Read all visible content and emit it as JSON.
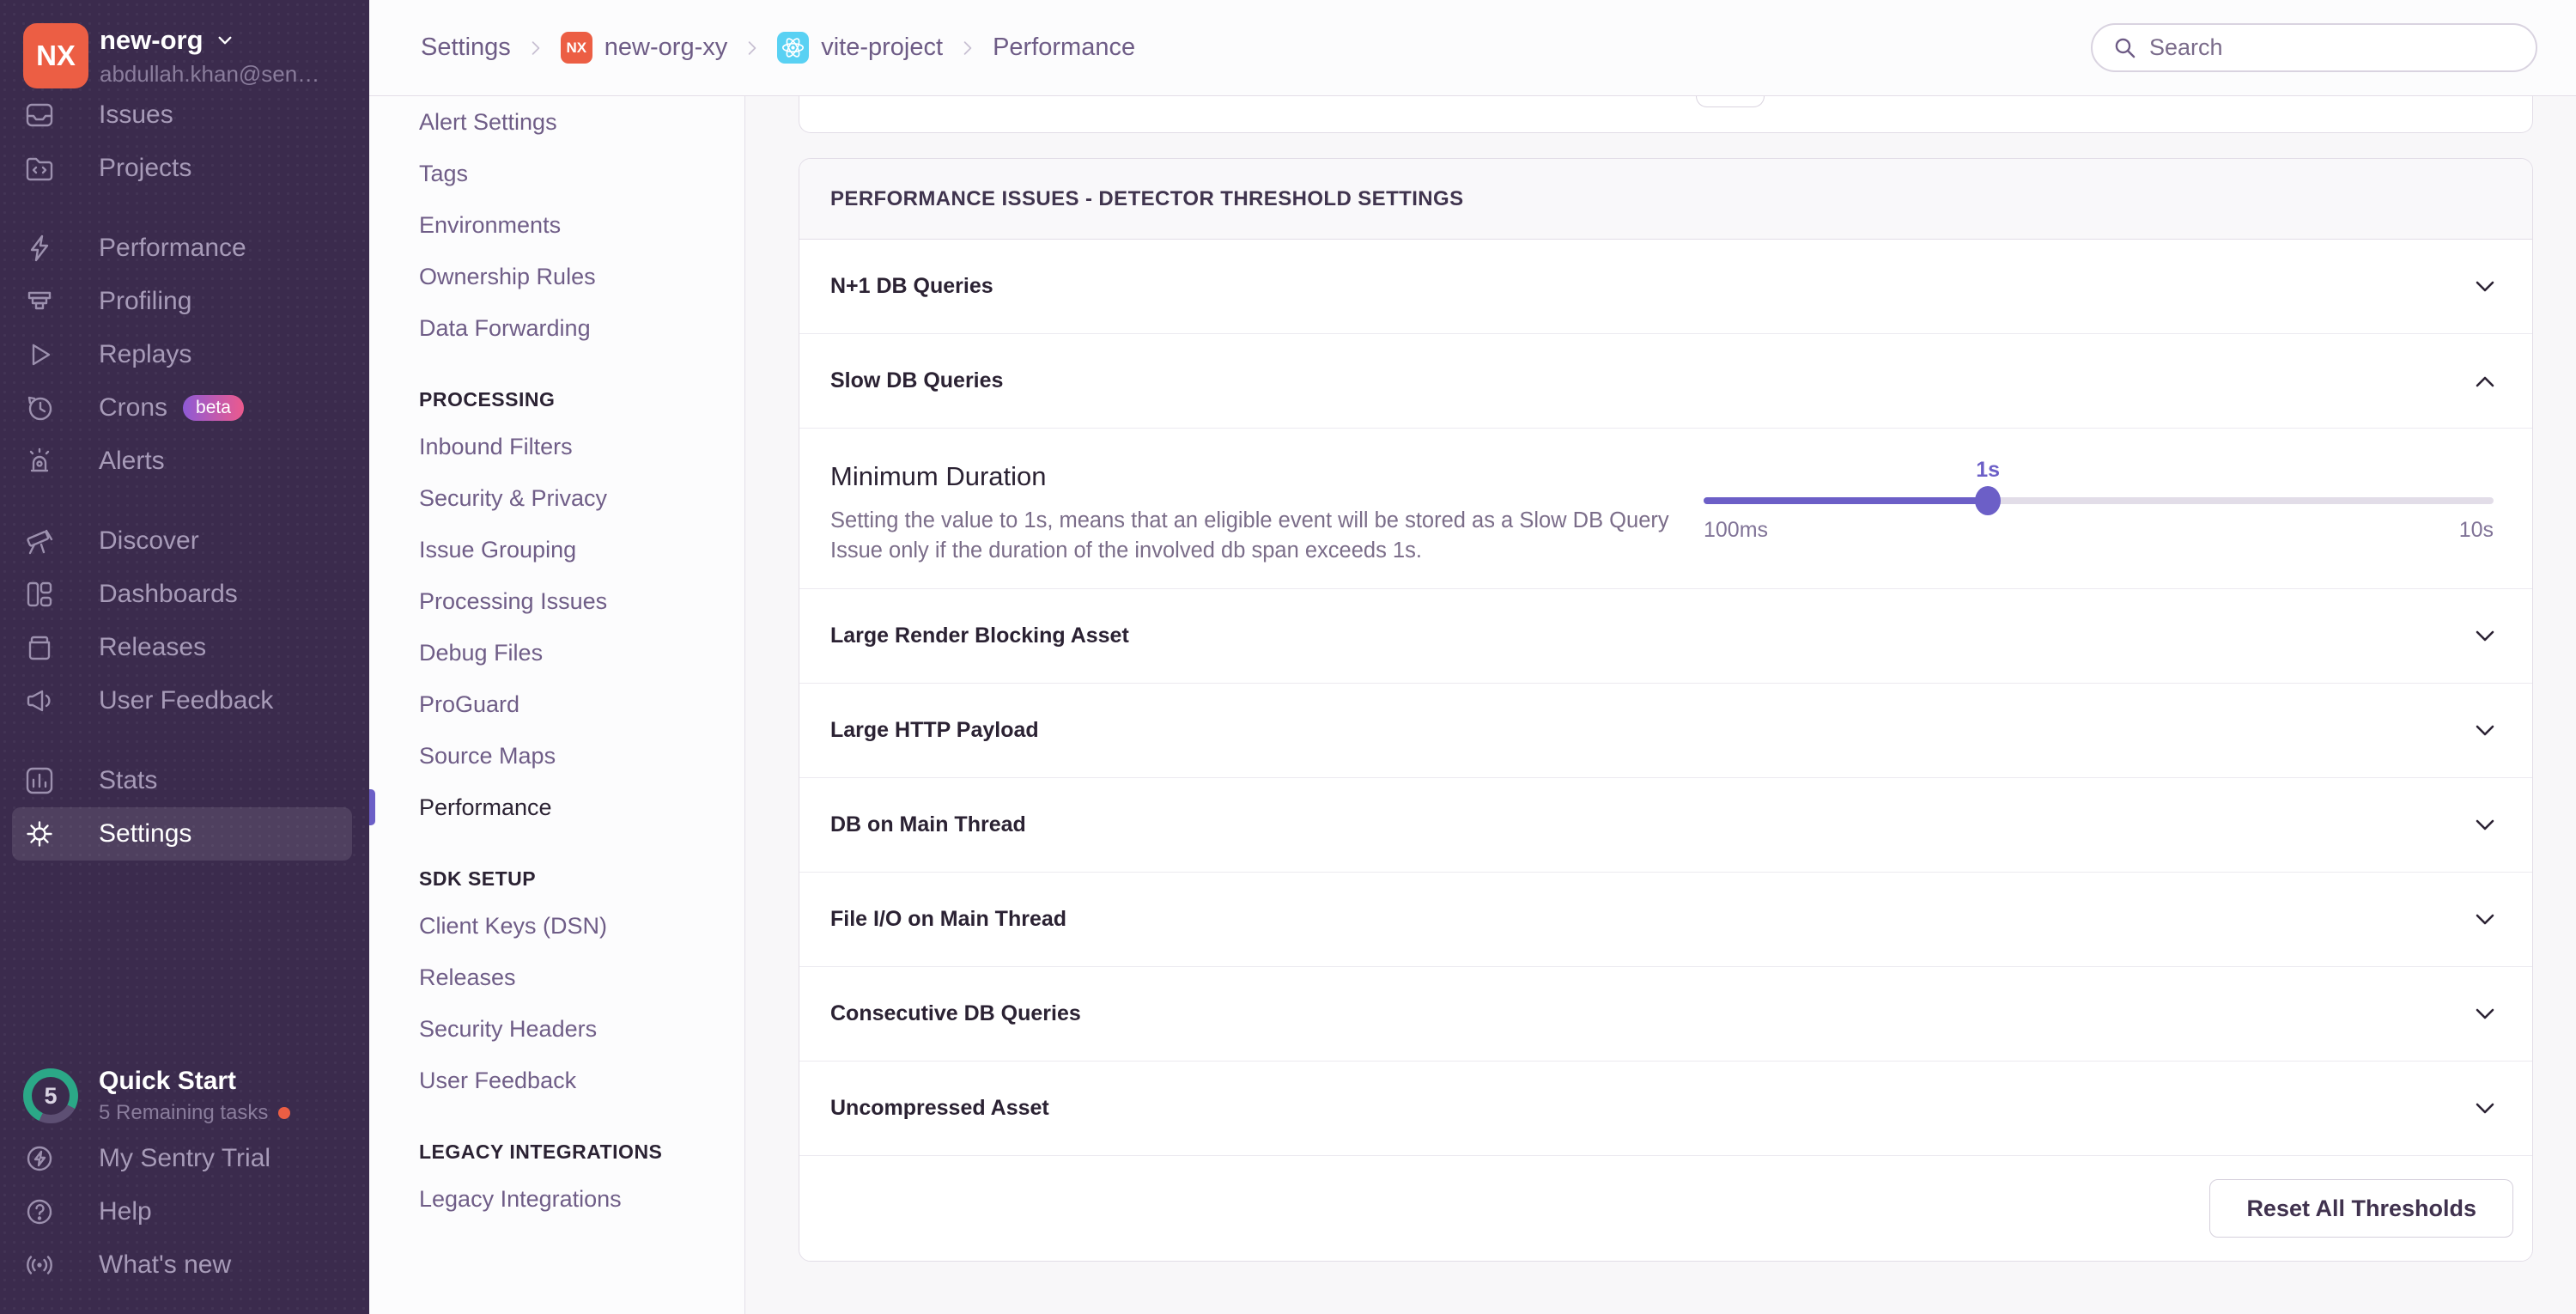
{
  "colors": {
    "sidebar_bg": "#3b2b4d",
    "accent_purple": "#6c5fc7",
    "org_avatar_orange": "#ec5e44",
    "react_badge_blue": "#59d1f3",
    "beta_gradient_start": "#8e5ad6",
    "beta_gradient_end": "#ec5a8d",
    "quickstart_ring_teal": "#2ba887"
  },
  "sidebar": {
    "org": {
      "avatar_initials": "NX",
      "name": "new-org",
      "email": "abdullah.khan@sen…"
    },
    "menu": [
      {
        "icon": "issues",
        "label": "Issues"
      },
      {
        "icon": "projects",
        "label": "Projects"
      },
      {
        "icon": "performance",
        "label": "Performance",
        "gap": true
      },
      {
        "icon": "profiling",
        "label": "Profiling"
      },
      {
        "icon": "replays",
        "label": "Replays"
      },
      {
        "icon": "crons",
        "label": "Crons",
        "badge": "beta"
      },
      {
        "icon": "alerts",
        "label": "Alerts"
      },
      {
        "icon": "discover",
        "label": "Discover",
        "gap": true
      },
      {
        "icon": "dashboards",
        "label": "Dashboards"
      },
      {
        "icon": "releases",
        "label": "Releases"
      },
      {
        "icon": "user-feedback",
        "label": "User Feedback"
      },
      {
        "icon": "stats",
        "label": "Stats",
        "gap": true
      },
      {
        "icon": "settings",
        "label": "Settings",
        "active": true
      }
    ],
    "quick_start": {
      "title": "Quick Start",
      "subtitle": "5 Remaining tasks",
      "count": "5"
    },
    "footer_menu": [
      {
        "icon": "trial",
        "label": "My Sentry Trial"
      },
      {
        "icon": "help",
        "label": "Help"
      },
      {
        "icon": "whats-new",
        "label": "What's new"
      }
    ]
  },
  "header": {
    "breadcrumb": {
      "settings": "Settings",
      "org_badge": "NX",
      "org": "new-org-xy",
      "project": "vite-project",
      "page": "Performance"
    },
    "search_placeholder": "Search"
  },
  "settings_nav": {
    "entries": [
      {
        "type": "item",
        "label": "Alert Settings"
      },
      {
        "type": "item",
        "label": "Tags"
      },
      {
        "type": "item",
        "label": "Environments"
      },
      {
        "type": "item",
        "label": "Ownership Rules"
      },
      {
        "type": "item",
        "label": "Data Forwarding"
      },
      {
        "type": "heading",
        "label": "PROCESSING"
      },
      {
        "type": "item",
        "label": "Inbound Filters"
      },
      {
        "type": "item",
        "label": "Security & Privacy"
      },
      {
        "type": "item",
        "label": "Issue Grouping"
      },
      {
        "type": "item",
        "label": "Processing Issues"
      },
      {
        "type": "item",
        "label": "Debug Files"
      },
      {
        "type": "item",
        "label": "ProGuard"
      },
      {
        "type": "item",
        "label": "Source Maps"
      },
      {
        "type": "item",
        "label": "Performance",
        "active": true
      },
      {
        "type": "heading",
        "label": "SDK SETUP"
      },
      {
        "type": "item",
        "label": "Client Keys (DSN)"
      },
      {
        "type": "item",
        "label": "Releases"
      },
      {
        "type": "item",
        "label": "Security Headers"
      },
      {
        "type": "item",
        "label": "User Feedback"
      },
      {
        "type": "heading",
        "label": "LEGACY INTEGRATIONS"
      },
      {
        "type": "item",
        "label": "Legacy Integrations"
      }
    ]
  },
  "main": {
    "panel_title": "PERFORMANCE ISSUES - DETECTOR THRESHOLD SETTINGS",
    "rows_top": [
      {
        "label": "N+1 DB Queries"
      }
    ],
    "expanded_row": {
      "label": "Slow DB Queries"
    },
    "slow_db_detail": {
      "setting_label": "Minimum Duration",
      "description": "Setting the value to 1s, means that an eligible event will be stored as a Slow DB Query Issue only if the duration of the involved db span exceeds 1s.",
      "slider": {
        "value_label": "1s",
        "min_label": "100ms",
        "max_label": "10s",
        "percent": 36
      }
    },
    "rows_bottom": [
      {
        "label": "Large Render Blocking Asset"
      },
      {
        "label": "Large HTTP Payload"
      },
      {
        "label": "DB on Main Thread"
      },
      {
        "label": "File I/O on Main Thread"
      },
      {
        "label": "Consecutive DB Queries"
      },
      {
        "label": "Uncompressed Asset"
      }
    ],
    "reset_button": "Reset All Thresholds"
  }
}
